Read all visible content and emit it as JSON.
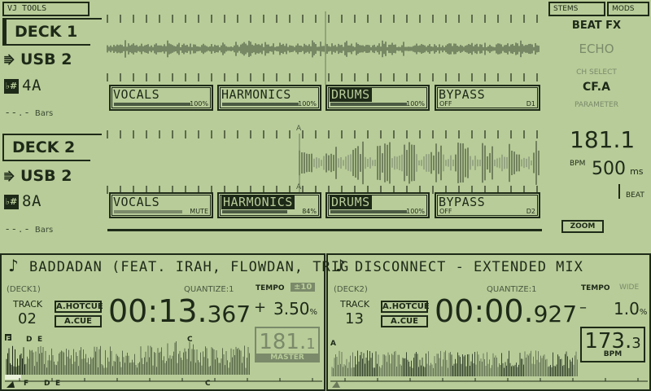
{
  "top": {
    "vj_tools": "VJ TOOLS",
    "stems_tab": "STEMS",
    "mods_tab": "MODS"
  },
  "deck1": {
    "tab": "DECK 1",
    "source": "USB 2",
    "key": "4A",
    "bars": "- - . -",
    "bars_unit": "Bars",
    "stems": [
      {
        "label": "VOCALS",
        "value": "100%"
      },
      {
        "label": "HARMONICS",
        "value": "100%"
      },
      {
        "label": "DRUMS",
        "value": "100%"
      },
      {
        "label": "BYPASS",
        "off": "OFF",
        "slot": "D1"
      }
    ]
  },
  "deck2": {
    "tab": "DECK 2",
    "source": "USB 2",
    "key": "8A",
    "bars": "- - . -",
    "bars_unit": "Bars",
    "stems": [
      {
        "label": "VOCALS",
        "value": "MUTE"
      },
      {
        "label": "HARMONICS",
        "value": "84%"
      },
      {
        "label": "DRUMS",
        "value": "100%"
      },
      {
        "label": "BYPASS",
        "off": "OFF",
        "slot": "D2"
      }
    ],
    "marker": "A"
  },
  "fx": {
    "beat_fx": "BEAT FX",
    "effect": "ECHO",
    "ch_select_label": "CH SELECT",
    "ch_select_value": "CF.A",
    "parameter_label": "PARAMETER",
    "bpm_value": "181.1",
    "bpm_unit": "BPM",
    "ms_value": "500",
    "ms_unit": "ms",
    "beat_label": "BEAT",
    "zoom": "ZOOM"
  },
  "player1": {
    "title": "BADDADAN (FEAT. IRAH, FLOWDAN, TRIG",
    "deck": "DECK1",
    "quantize": "QUANTIZE:1",
    "tempo_label": "TEMPO",
    "tempo_range": "±10",
    "track_label": "TRACK",
    "track_number": "02",
    "hotcue": "A.HOTCUE",
    "acue": "A.CUE",
    "time_main": "00:13.",
    "time_ms": "367",
    "tempo_sign": "+",
    "tempo_value": "3.50",
    "tempo_unit": "%",
    "bpm": "181.",
    "bpm_dec": "1",
    "master": "MASTER",
    "cue_markers": [
      "F",
      "D",
      "E",
      "C"
    ]
  },
  "player2": {
    "title": "DISCONNECT - EXTENDED MIX",
    "deck": "DECK2",
    "quantize": "QUANTIZE:1",
    "tempo_label": "TEMPO",
    "tempo_range": "WIDE",
    "track_label": "TRACK",
    "track_number": "13",
    "hotcue": "A.HOTCUE",
    "acue": "A.CUE",
    "time_main": "00:00.",
    "time_ms": "927",
    "tempo_sign": "–",
    "tempo_value": "1.0",
    "tempo_unit": "%",
    "bpm": "173.",
    "bpm_dec": "3",
    "bpm_unit": "BPM",
    "cue_marker": "A"
  },
  "colors": {
    "background": "#b8cc99",
    "ink": "#1e2a18",
    "dim": "#4a5a42"
  }
}
